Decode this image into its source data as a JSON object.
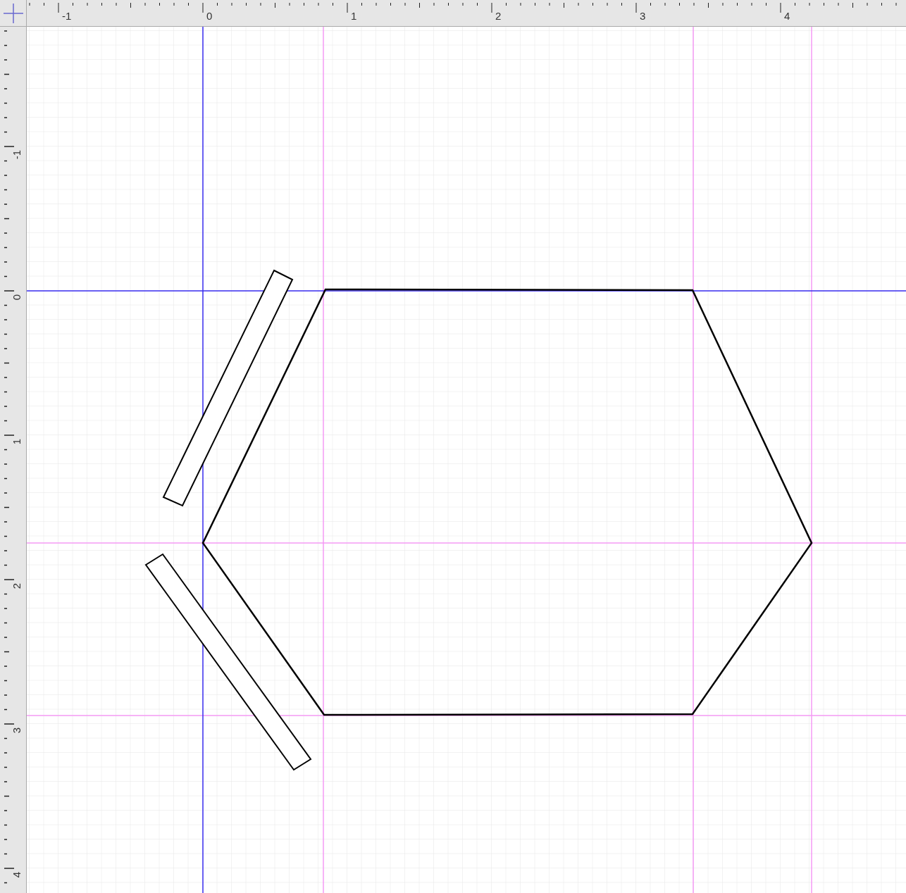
{
  "horizontal_ruler": {
    "labels": [
      "-1",
      "0",
      "1",
      "2",
      "3",
      "4"
    ]
  },
  "vertical_ruler": {
    "labels": [
      "-1",
      "0",
      "1",
      "2",
      "3",
      "4"
    ]
  }
}
